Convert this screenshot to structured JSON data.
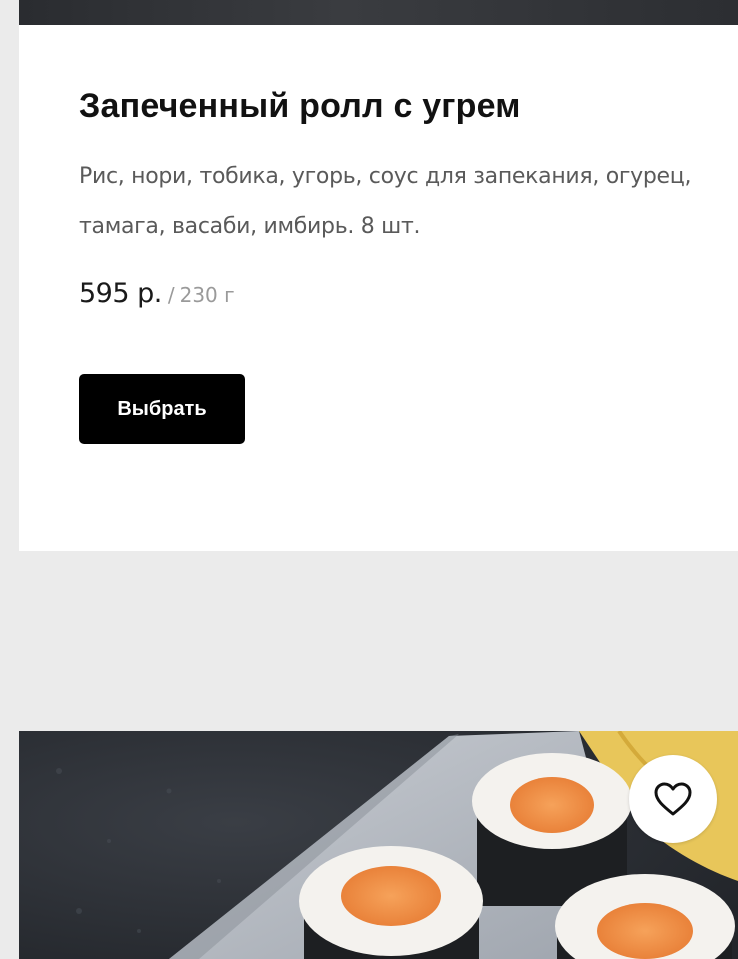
{
  "product": {
    "title": "Запеченный ролл с угрем",
    "description": "Рис, нори, тобика, угорь, соус для запекания, огурец, тамага, васаби, имбирь. 8 шт.",
    "price": "595 р.",
    "weight_separator": "/",
    "weight": "230 г",
    "select_label": "Выбрать"
  },
  "next_product": {
    "image_icon": "sushi-rolls-photo",
    "favorite_icon": "heart-outline-icon"
  },
  "colors": {
    "page_background": "#ebebeb",
    "card_background": "#ffffff",
    "button_background": "#000000",
    "button_text": "#ffffff",
    "title_text": "#111111",
    "description_text": "#5a5a5a",
    "weight_text": "#9a9a9a"
  }
}
